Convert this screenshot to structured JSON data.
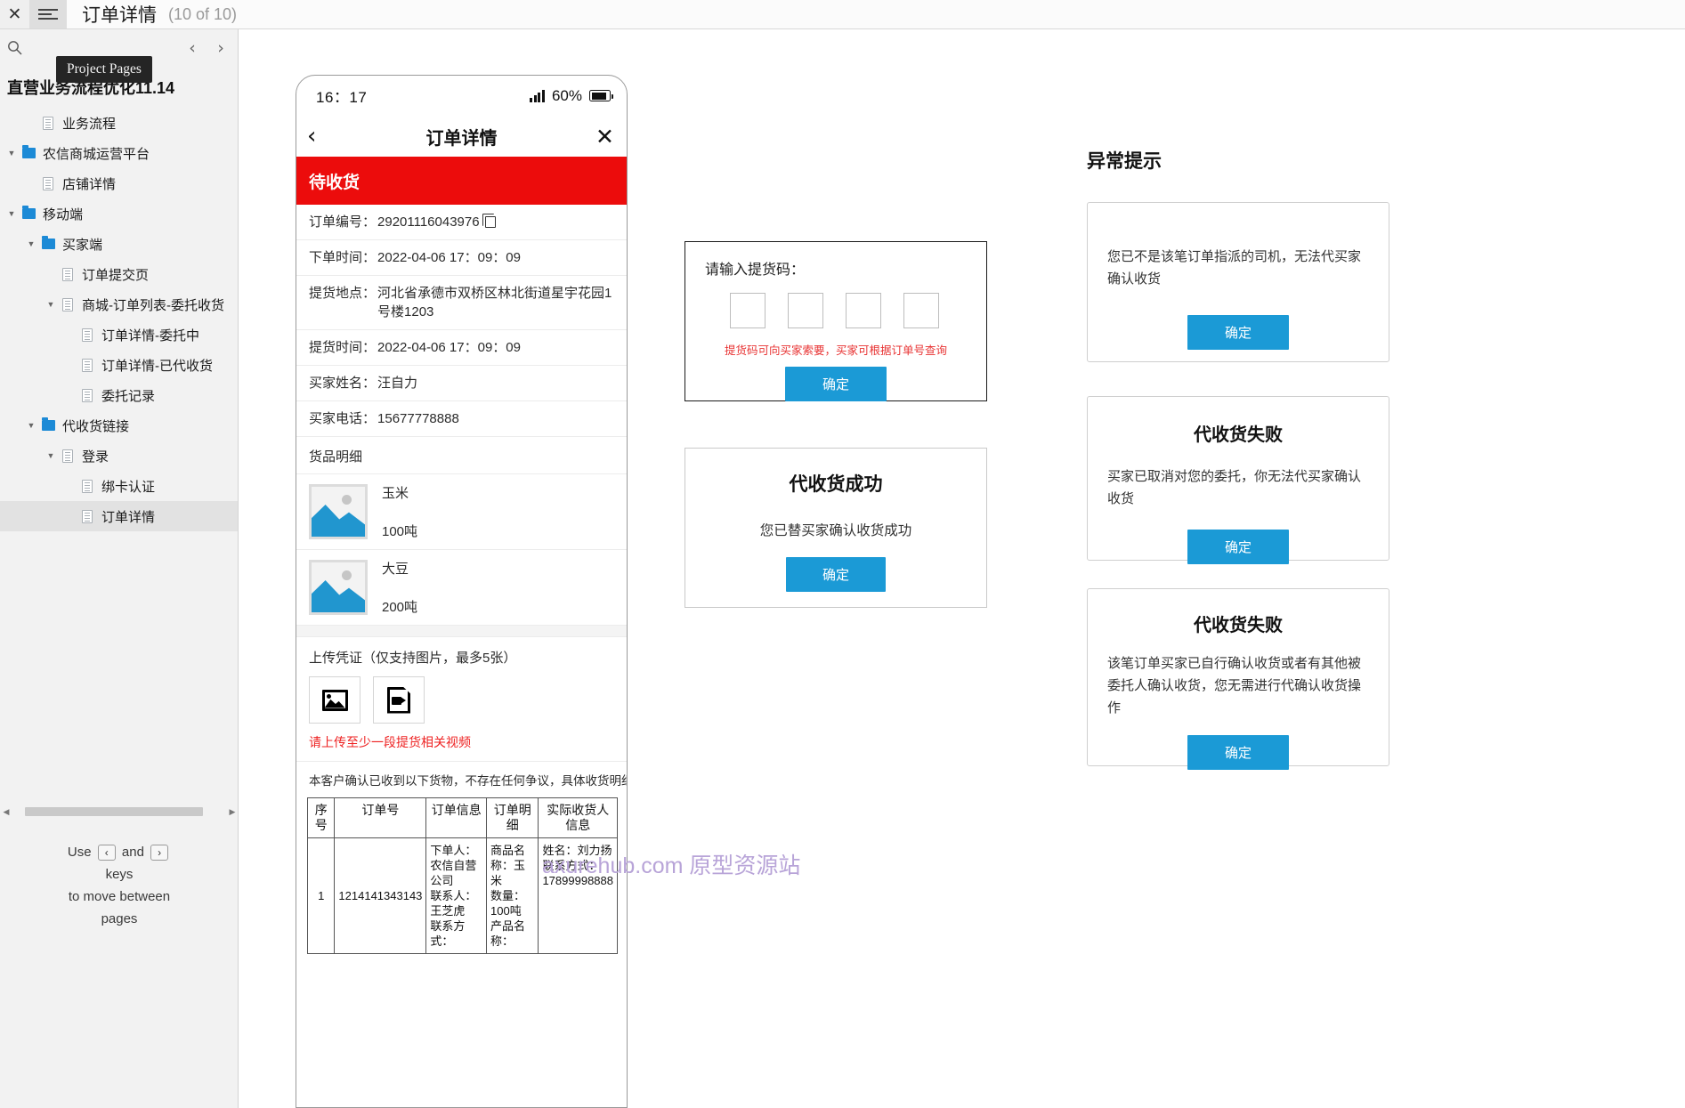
{
  "topbar": {
    "close_icon": "close-icon",
    "menu_icon": "hamburger-icon",
    "page_title": "订单详情",
    "page_count": "(10 of 10)"
  },
  "left_panel": {
    "tooltip": "Project Pages",
    "search_icon": "search-icon",
    "prev_icon": "‹",
    "next_icon": "›",
    "project_title": "直营业务流程优化11.14",
    "tree": [
      {
        "label": "业务流程",
        "indent": 1,
        "type": "page",
        "arrow": "none",
        "selected": false
      },
      {
        "label": "农信商城运营平台",
        "indent": 0,
        "type": "folder",
        "arrow": "down",
        "selected": false
      },
      {
        "label": "店铺详情",
        "indent": 1,
        "type": "page",
        "arrow": "none",
        "selected": false
      },
      {
        "label": "移动端",
        "indent": 0,
        "type": "folder",
        "arrow": "down",
        "selected": false
      },
      {
        "label": "买家端",
        "indent": 1,
        "type": "folder",
        "arrow": "down",
        "selected": false
      },
      {
        "label": "订单提交页",
        "indent": 2,
        "type": "page",
        "arrow": "none",
        "selected": false
      },
      {
        "label": "商城-订单列表-委托收货",
        "indent": 2,
        "type": "page",
        "arrow": "down",
        "selected": false
      },
      {
        "label": "订单详情-委托中",
        "indent": 3,
        "type": "page",
        "arrow": "none",
        "selected": false
      },
      {
        "label": "订单详情-已代收货",
        "indent": 3,
        "type": "page",
        "arrow": "none",
        "selected": false
      },
      {
        "label": "委托记录",
        "indent": 3,
        "type": "page",
        "arrow": "none",
        "selected": false
      },
      {
        "label": "代收货链接",
        "indent": 1,
        "type": "folder",
        "arrow": "down",
        "selected": false
      },
      {
        "label": "登录",
        "indent": 2,
        "type": "page",
        "arrow": "down",
        "selected": false
      },
      {
        "label": "绑卡认证",
        "indent": 3,
        "type": "page",
        "arrow": "none",
        "selected": false
      },
      {
        "label": "订单详情",
        "indent": 3,
        "type": "page",
        "arrow": "none",
        "selected": true
      }
    ],
    "hint": {
      "line1_a": "Use",
      "key_prev": "‹",
      "line1_b": "and",
      "key_next": "›",
      "line2": "keys",
      "line3": "to move between",
      "line4": "pages"
    }
  },
  "phone": {
    "status_bar": {
      "time": "16：17",
      "battery": "60%",
      "signal_icon": "signal-bars-icon",
      "battery_icon": "battery-icon"
    },
    "nav": {
      "back_icon": "‹",
      "title": "订单详情",
      "close_icon": "✕"
    },
    "banner": "待收货",
    "info_rows": [
      {
        "key": "订单编号：",
        "value": "29201116043976",
        "copy": true
      },
      {
        "key": "下单时间：",
        "value": "2022-04-06 17：09：09",
        "copy": false
      },
      {
        "key": "提货地点：",
        "value": "河北省承德市双桥区林北街道星宇花园1号楼1203",
        "copy": false
      },
      {
        "key": "提货时间：",
        "value": "2022-04-06 17：09：09",
        "copy": false
      },
      {
        "key": "买家姓名：",
        "value": "汪自力",
        "copy": false
      },
      {
        "key": "买家电话：",
        "value": "15677778888",
        "copy": false
      }
    ],
    "goods_label": "货品明细",
    "goods": [
      {
        "name": "玉米",
        "qty": "100吨"
      },
      {
        "name": "大豆",
        "qty": "200吨"
      }
    ],
    "upload": {
      "caption": "上传凭证（仅支持图片，最多5张）",
      "image_icon": "image-upload-icon",
      "video_icon": "video-upload-icon",
      "warning": "请上传至少一段提货相关视频"
    },
    "disclaimer": "本客户确认已收到以下货物，不存在任何争议，具体收货明细如下",
    "table": {
      "headers": [
        "序号",
        "订单号",
        "订单信息",
        "订单明细",
        "实际收货人信息"
      ],
      "rows": [
        {
          "no": "1",
          "order_no": "1214141343143",
          "order_info": "下单人：农信自营公司\n联系人：王芝虎\n联系方式：",
          "order_detail": "商品名称：玉米\n数量：100吨\n产品名称：",
          "receiver": "姓名：刘力扬\n联系方式：17899998888"
        }
      ]
    }
  },
  "mid_dialogs": {
    "code_dialog": {
      "label": "请输入提货码：",
      "boxes": [
        "",
        "",
        "",
        ""
      ],
      "hint": "提货码可向买家索要，买家可根据订单号查询",
      "confirm": "确定"
    },
    "success_dialog": {
      "title": "代收货成功",
      "body": "您已替买家确认收货成功",
      "confirm": "确定"
    }
  },
  "right_column": {
    "heading": "异常提示",
    "cards": [
      {
        "title": "",
        "body": "您已不是该笔订单指派的司机，无法代买家确认收货",
        "confirm": "确定"
      },
      {
        "title": "代收货失败",
        "body": "买家已取消对您的委托，你无法代买家确认收货",
        "confirm": "确定"
      },
      {
        "title": "代收货失败",
        "body": "该笔订单买家已自行确认收货或者有其他被委托人确认收货，您无需进行代确认收货操作",
        "confirm": "确定"
      }
    ]
  },
  "watermark": "axurehub.com 原型资源站",
  "colors": {
    "accent_blue": "#1b9ad6",
    "banner_red": "#ec0c0c",
    "warn_red": "#ee2222",
    "folder_blue": "#1c8ad6"
  }
}
